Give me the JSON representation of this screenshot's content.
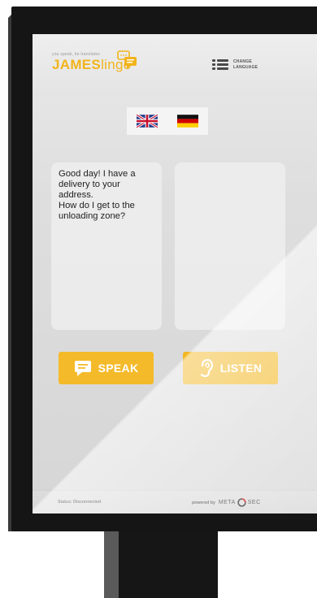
{
  "header": {
    "tagline": "you speak, he translates",
    "brand_bold": "JAMES",
    "brand_light": "lingo",
    "change_language_line1": "CHANGE",
    "change_language_line2": "LANGUAGE"
  },
  "flags": {
    "source_language": "English (UK)",
    "target_language": "German"
  },
  "panels": {
    "left_text": "Good day! I have a delivery to your address.\nHow do I get to the unloading zone?",
    "right_text": ""
  },
  "buttons": {
    "speak_label": "SPEAK",
    "listen_label": "LISTEN"
  },
  "footer": {
    "status": "Status: Disconnected",
    "powered_by": "powered by",
    "brand_left": "META",
    "brand_right": "SEC"
  },
  "colors": {
    "accent": "#f2b61e",
    "screen_bg": "#dedede",
    "frame": "#151515"
  }
}
